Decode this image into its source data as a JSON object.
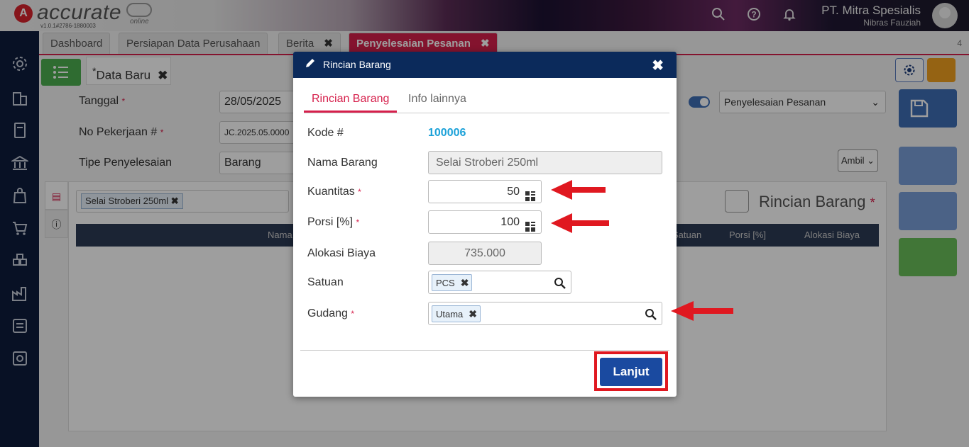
{
  "app": {
    "logo_letter": "A",
    "logo_name": "accurate",
    "logo_sub": "online",
    "version": "v1.0.1#2786-1880003",
    "company": "PT. Mitra Spesialis",
    "user": "Nibras Fauziah"
  },
  "tabs": [
    {
      "label": "Dashboard"
    },
    {
      "label": "Persiapan Data Perusahaan"
    },
    {
      "label": "Berita",
      "close": "✖"
    },
    {
      "label": "Penyelesaian Pesanan",
      "close": "✖"
    }
  ],
  "tab_count": "4",
  "form": {
    "subtab_prefix": "*",
    "subtab_label": "Data Baru",
    "subtab_close": "✖",
    "tanggal_label": "Tanggal",
    "tanggal_value": "28/05/2025",
    "no_pekerjaan_label": "No Pekerjaan #",
    "no_pekerjaan_value": "JC.2025.05.0000",
    "tipe_label": "Tipe Penyelesaian",
    "tipe_value": "Barang",
    "required_mark": "*",
    "status_select": "Penyelesaian Pesanan",
    "ambil_label": "Ambil",
    "item_chip": "Selai Stroberi 250ml",
    "section_title": "Rincian Barang",
    "table_headers": [
      "Nama",
      "Satuan",
      "Porsi [%]",
      "Alokasi Biaya"
    ]
  },
  "modal": {
    "title": "Rincian Barang",
    "close": "✖",
    "tabs": [
      "Rincian Barang",
      "Info lainnya"
    ],
    "kode_label": "Kode #",
    "kode_value": "100006",
    "nama_label": "Nama Barang",
    "nama_value": "Selai Stroberi 250ml",
    "kuantitas_label": "Kuantitas",
    "kuantitas_value": "50",
    "porsi_label": "Porsi [%]",
    "porsi_value": "100",
    "alokasi_label": "Alokasi Biaya",
    "alokasi_value": "735.000",
    "satuan_label": "Satuan",
    "satuan_value": "PCS",
    "gudang_label": "Gudang",
    "gudang_value": "Utama",
    "required_mark": "*",
    "chip_close": "✖",
    "lanjut_label": "Lanjut"
  },
  "colors": {
    "accent_red": "#d61f4b",
    "header_navy": "#0b2a5b",
    "link_blue": "#1ba1d8",
    "button_blue": "#1a4aa0",
    "annotation_red": "#e01820"
  }
}
